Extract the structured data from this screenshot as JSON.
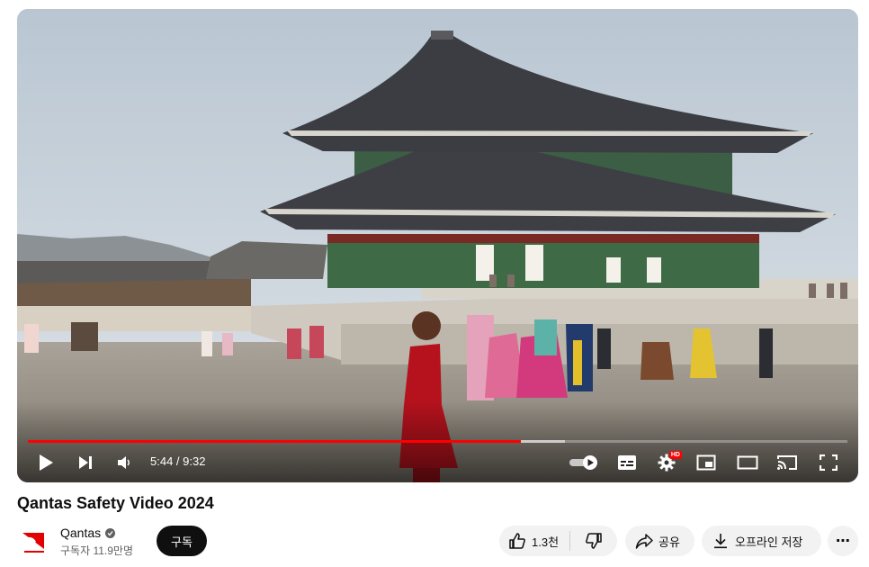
{
  "video": {
    "title": "Qantas Safety Video 2024",
    "current_time": "5:44",
    "duration": "9:32",
    "time_display": "5:44 / 9:32",
    "progress_fraction": 0.601,
    "buffered_fraction": 0.655,
    "hd_badge": "HD"
  },
  "channel": {
    "name": "Qantas",
    "subscribers": "구독자 11.9만명",
    "subscribe_label": "구독",
    "verified": true
  },
  "actions": {
    "like_count": "1.3천",
    "share_label": "공유",
    "offline_label": "오프라인 저장",
    "more_label": "⋯"
  },
  "icons": {
    "play": "play-icon",
    "next": "next-icon",
    "volume": "volume-icon",
    "autoplay": "autoplay-toggle-icon",
    "subtitles": "subtitles-icon",
    "settings": "gear-icon",
    "miniplayer": "miniplayer-icon",
    "theater": "theater-mode-icon",
    "cast": "cast-icon",
    "fullscreen": "fullscreen-icon",
    "like": "thumbs-up-icon",
    "dislike": "thumbs-down-icon",
    "share": "share-arrow-icon",
    "download": "download-icon"
  },
  "colors": {
    "progress_played": "#ff0000",
    "subscribe_bg": "#0f0f0f",
    "pill_bg": "#f2f2f2",
    "qantas_red": "#e40000"
  }
}
